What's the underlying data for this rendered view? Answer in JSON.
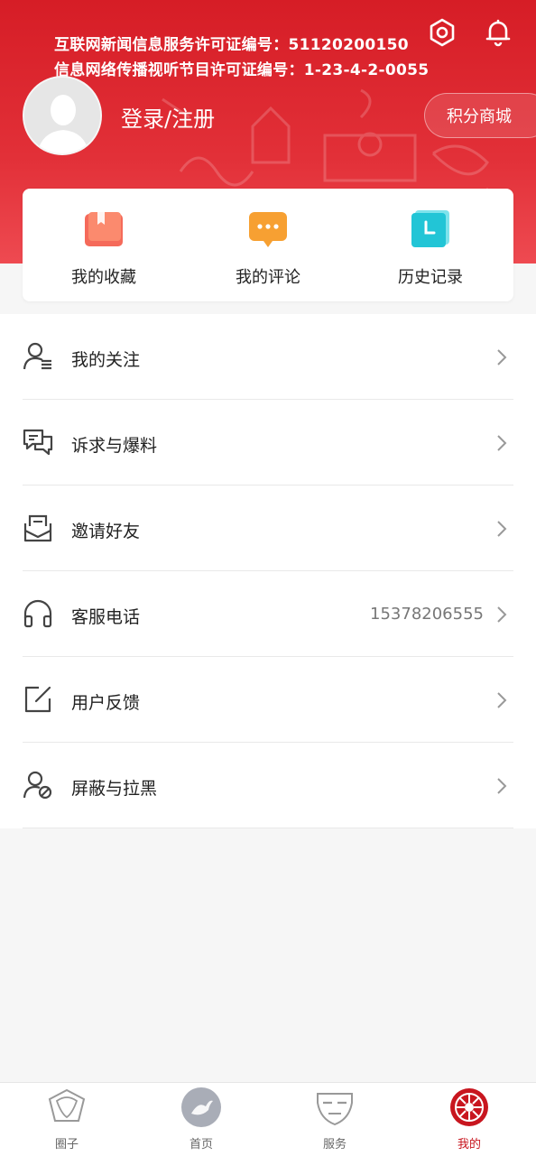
{
  "header": {
    "license_line1": "互联网新闻信息服务许可证编号：51120200150",
    "license_line2": "信息网络传播视听节目许可证编号：1-23-4-2-0055",
    "login_label": "登录/注册",
    "points_mall_label": "积分商城",
    "icons": [
      "settings-hexagon-icon",
      "bell-icon",
      "avatar-placeholder-icon"
    ]
  },
  "quick_actions": [
    {
      "label": "我的收藏",
      "icon": "favorites-book-icon",
      "color": "#f56a5a"
    },
    {
      "label": "我的评论",
      "icon": "comment-bubble-icon",
      "color": "#f7a032"
    },
    {
      "label": "历史记录",
      "icon": "history-clock-icon",
      "color": "#22c5d6"
    }
  ],
  "menu": [
    {
      "label": "我的关注",
      "icon": "follow-user-icon",
      "value": ""
    },
    {
      "label": "诉求与爆料",
      "icon": "chat-bubbles-icon",
      "value": ""
    },
    {
      "label": "邀请好友",
      "icon": "invite-mail-icon",
      "value": ""
    },
    {
      "label": "客服电话",
      "icon": "headphones-icon",
      "value": "15378206555"
    },
    {
      "label": "用户反馈",
      "icon": "edit-feedback-icon",
      "value": ""
    },
    {
      "label": "屏蔽与拉黑",
      "icon": "block-user-icon",
      "value": ""
    }
  ],
  "tabs": [
    {
      "label": "圈子",
      "icon": "circle-emblem-icon",
      "active": false
    },
    {
      "label": "首页",
      "icon": "home-bird-icon",
      "active": false
    },
    {
      "label": "服务",
      "icon": "mask-service-icon",
      "active": false
    },
    {
      "label": "我的",
      "icon": "profile-emblem-icon",
      "active": true
    }
  ],
  "colors": {
    "brand_red": "#d61d26",
    "active_tab": "#c8161f",
    "text": "#222222",
    "muted": "#777777"
  }
}
